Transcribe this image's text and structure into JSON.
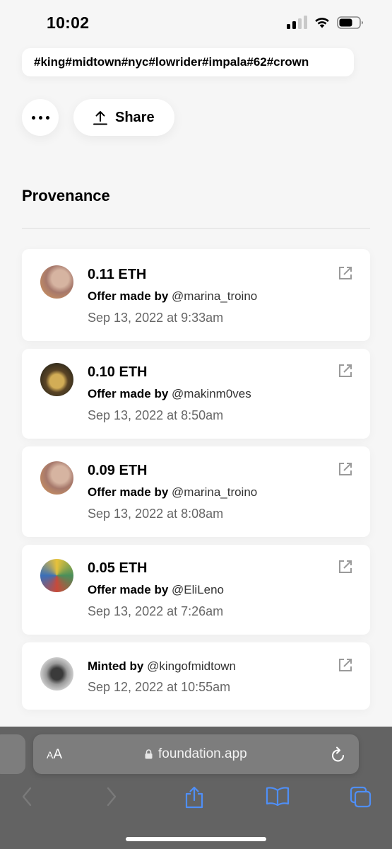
{
  "status": {
    "time": "10:02"
  },
  "tags": "#king#midtown#nyc#lowrider#impala#62#crown",
  "share_label": "Share",
  "section_title": "Provenance",
  "history": [
    {
      "price": "0.11 ETH",
      "action": "Offer made by",
      "handle": "@marina_troino",
      "date": "Sep 13, 2022 at 9:33am"
    },
    {
      "price": "0.10 ETH",
      "action": "Offer made by",
      "handle": "@makinm0ves",
      "date": "Sep 13, 2022 at 8:50am"
    },
    {
      "price": "0.09 ETH",
      "action": "Offer made by",
      "handle": "@marina_troino",
      "date": "Sep 13, 2022 at 8:08am"
    },
    {
      "price": "0.05 ETH",
      "action": "Offer made by",
      "handle": "@EliLeno",
      "date": "Sep 13, 2022 at 7:26am"
    },
    {
      "action": "Minted by",
      "handle": "@kingofmidtown",
      "date": "Sep 12, 2022 at 10:55am"
    }
  ],
  "browser": {
    "aa_small": "A",
    "aa_large": "A",
    "url": "foundation.app"
  },
  "colors": {
    "accent_blue": "#4f8ff7",
    "toolbar": "#636363"
  }
}
